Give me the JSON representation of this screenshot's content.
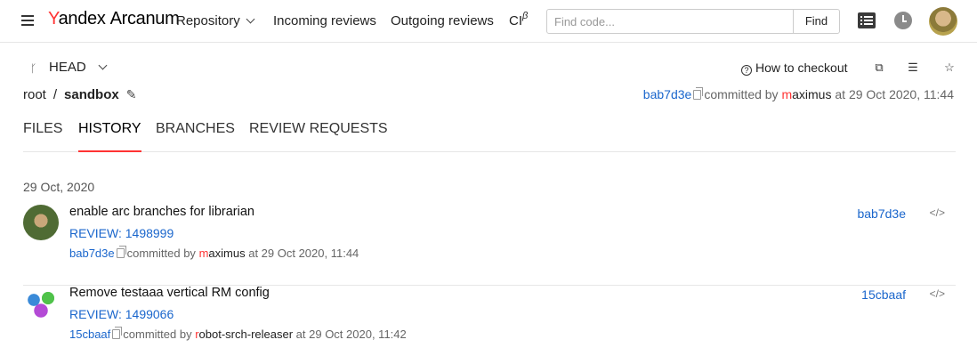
{
  "header": {
    "logo_brand_first": "Y",
    "logo_brand_rest": "andex",
    "logo_product": "Arcanum",
    "nav": {
      "repository": "Repository",
      "incoming": "Incoming reviews",
      "outgoing": "Outgoing reviews",
      "ci": "CI",
      "ci_sup": "β"
    },
    "search": {
      "placeholder": "Find code...",
      "value": "",
      "button": "Find"
    }
  },
  "toolbar": {
    "ref": "HEAD",
    "how_to_checkout": "How to checkout"
  },
  "breadcrumb": {
    "root": "root",
    "separator": "/",
    "current": "sandbox"
  },
  "last_commit": {
    "hash": "bab7d3e",
    "committed_by": "committed by",
    "user_first": "m",
    "user_rest": "aximus",
    "at": "at 29 Oct 2020, 11:44"
  },
  "tabs": [
    "FILES",
    "HISTORY",
    "BRANCHES",
    "REVIEW REQUESTS"
  ],
  "history": {
    "date": "29 Oct, 2020",
    "commits": [
      {
        "message": "enable arc branches for librarian",
        "review": "REVIEW: 1498999",
        "hash": "bab7d3e",
        "committed_by": "committed by",
        "user_first": "m",
        "user_rest": "aximus",
        "at": "at 29 Oct 2020, 11:44",
        "right_hash": "bab7d3e",
        "code_icon": "</>"
      },
      {
        "message": "Remove testaaa vertical RM config",
        "review": "REVIEW: 1499066",
        "hash": "15cbaaf",
        "committed_by": "committed by",
        "user_first": "r",
        "user_rest": "obot-srch-releaser",
        "at": "at 29 Oct 2020, 11:42",
        "right_hash": "15cbaaf",
        "code_icon": "</>"
      }
    ]
  },
  "colors": {
    "accent_red": "#ff3333",
    "link_blue": "#1a66cc"
  }
}
